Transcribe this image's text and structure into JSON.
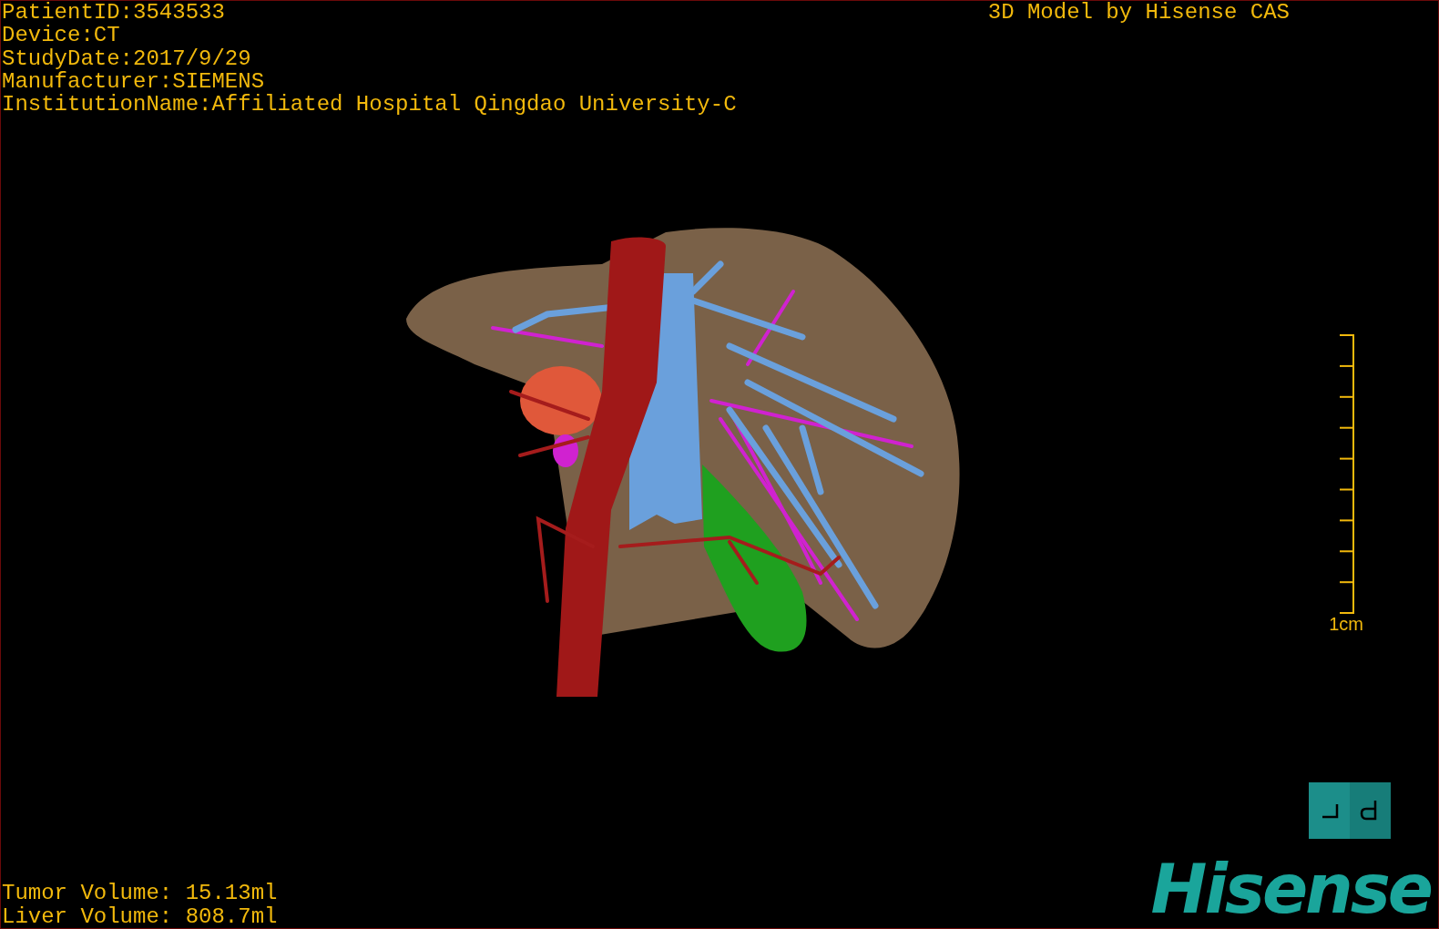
{
  "overlay": {
    "patient_info": [
      "PatientID:3543533",
      "Device:CT",
      "StudyDate:2017/9/29",
      "Manufacturer:SIEMENS",
      "InstitutionName:Affiliated Hospital Qingdao University-C"
    ],
    "title": "3D Model by Hisense CAS",
    "volumes": [
      "Tumor Volume: 15.13ml",
      "Liver Volume: 808.7ml"
    ]
  },
  "scale_bar": {
    "label": "1cm"
  },
  "logo": {
    "text": "Hisense"
  }
}
